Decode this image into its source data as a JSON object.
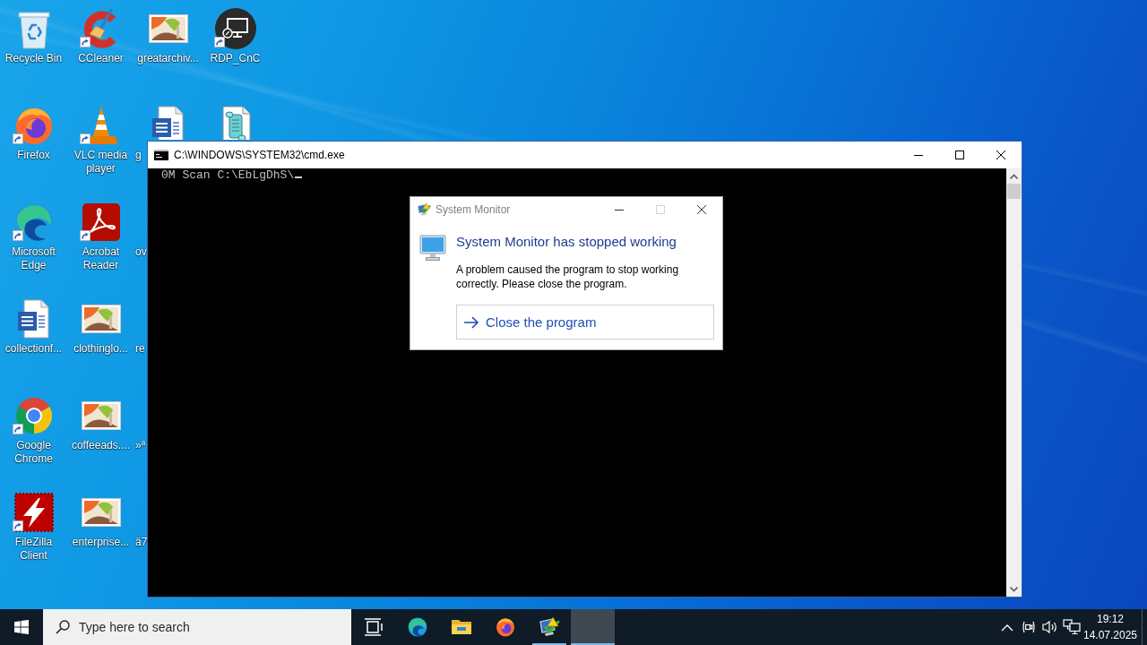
{
  "desktop": {
    "icons": [
      {
        "label": "Recycle Bin",
        "kind": "recycle-bin",
        "shortcut": false,
        "covered": false
      },
      {
        "label": "Firefox",
        "kind": "firefox",
        "shortcut": true,
        "covered": false
      },
      {
        "label": "Microsoft Edge",
        "kind": "edge",
        "shortcut": true,
        "covered": false
      },
      {
        "label": "collectionf...",
        "kind": "word-document",
        "shortcut": false,
        "covered": false
      },
      {
        "label": "Google Chrome",
        "kind": "chrome",
        "shortcut": true,
        "covered": false
      },
      {
        "label": "FileZilla Client",
        "kind": "filezilla",
        "shortcut": true,
        "covered": false
      },
      {
        "label": "CCleaner",
        "kind": "ccleaner",
        "shortcut": true,
        "covered": false
      },
      {
        "label": "VLC media player",
        "kind": "vlc",
        "shortcut": true,
        "covered": false
      },
      {
        "label": "Acrobat Reader",
        "kind": "acrobat",
        "shortcut": true,
        "covered": false
      },
      {
        "label": "clothinglo...",
        "kind": "image-file",
        "shortcut": false,
        "covered": false
      },
      {
        "label": "coffeeads....",
        "kind": "image-file",
        "shortcut": false,
        "covered": false
      },
      {
        "label": "enterprise...",
        "kind": "image-file",
        "shortcut": false,
        "covered": false
      },
      {
        "label": "greatarchiv...",
        "kind": "image-file",
        "shortcut": false,
        "covered": false
      },
      {
        "label": "g",
        "kind": "word-document",
        "shortcut": false,
        "covered": true
      },
      {
        "label": "ov",
        "covered": true
      },
      {
        "label": "re",
        "covered": true
      },
      {
        "label": "»ª",
        "covered": true
      },
      {
        "label": "ä7",
        "covered": true
      },
      {
        "label": "RDP_CnC",
        "kind": "remote-desktop",
        "shortcut": true,
        "covered": false
      },
      {
        "kind": "script",
        "shortcut": false,
        "covered": true
      }
    ]
  },
  "console_window": {
    "title": "C:\\WINDOWS\\SYSTEM32\\cmd.exe",
    "lines": [
      "0M Scan C:\\EbLgDhS\\"
    ],
    "cursor_visible": true
  },
  "error_dialog": {
    "title": "System Monitor",
    "title_buttons": [
      {
        "kind": "minimize",
        "disabled": false
      },
      {
        "kind": "maximize",
        "disabled": true
      },
      {
        "kind": "close",
        "disabled": false
      }
    ],
    "heading": "System Monitor has stopped working",
    "message": "A problem caused the program to stop working correctly. Please close the program.",
    "action": "Close the program"
  },
  "taskbar": {
    "search": {
      "placeholder": "Type here to search"
    },
    "apps": [
      {
        "kind": "task-view",
        "running": false,
        "active": false
      },
      {
        "kind": "edge",
        "running": false,
        "active": false
      },
      {
        "kind": "file-explorer",
        "running": false,
        "active": false
      },
      {
        "kind": "firefox",
        "running": false,
        "active": false
      },
      {
        "kind": "system-monitor",
        "running": true,
        "active": false
      },
      {
        "running": true,
        "active": true
      }
    ],
    "clock": {
      "time": "19:12",
      "date": "14.07.2025"
    }
  }
}
